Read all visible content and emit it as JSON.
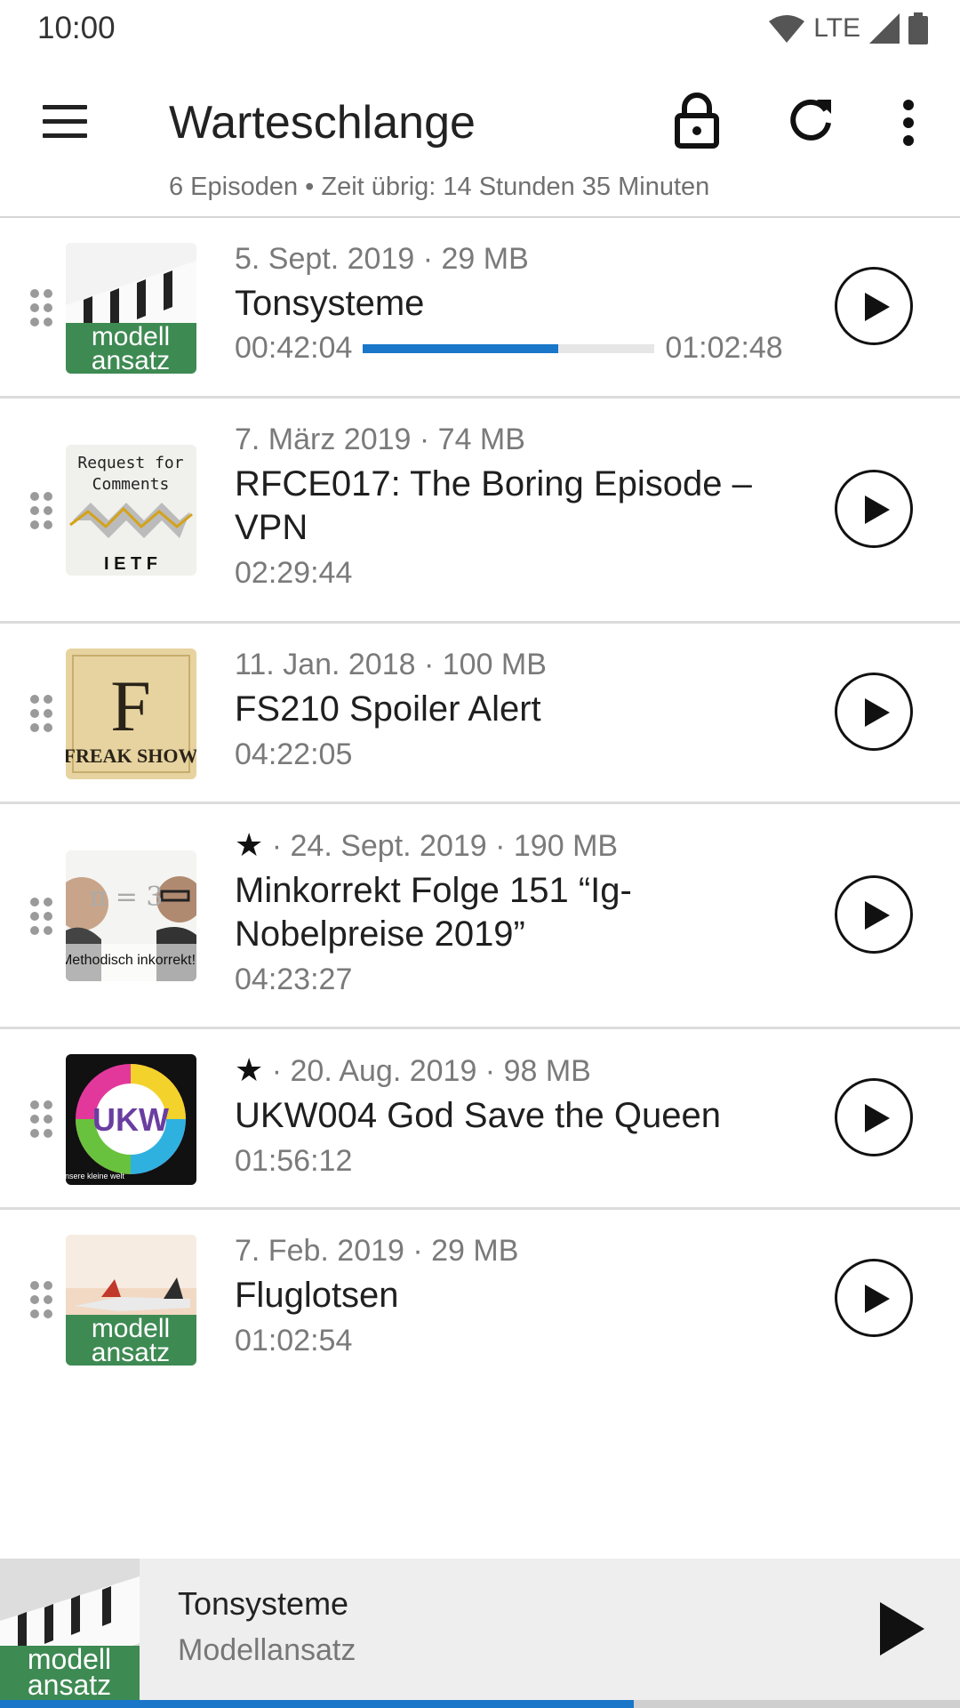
{
  "status_bar": {
    "time": "10:00",
    "network": "LTE"
  },
  "toolbar": {
    "title": "Warteschlange",
    "subtitle": "6 Episoden • Zeit übrig: 14 Stunden 35 Minuten"
  },
  "episodes": [
    {
      "meta": "5. Sept. 2019 · 29 MB",
      "starred": false,
      "title": "Tonsysteme",
      "position": "00:42:04",
      "duration": "01:02:48",
      "progress": 0.67,
      "cover": {
        "label_top": "modell",
        "label_bottom": "ansatz",
        "style": "piano"
      }
    },
    {
      "meta": "7. März 2019 · 74 MB",
      "starred": false,
      "title": "RFCE017: The Boring Episode – VPN",
      "duration": "02:29:44",
      "cover": {
        "label_top": "Request for",
        "label_mid": "Comments",
        "label_bottom": "I E T F",
        "style": "ietf"
      }
    },
    {
      "meta": "11. Jan. 2018 · 100 MB",
      "starred": false,
      "title": "FS210 Spoiler Alert",
      "duration": "04:22:05",
      "cover": {
        "label_top": "F",
        "label_bottom": "FREAK SHOW",
        "style": "freakshow"
      }
    },
    {
      "meta": "· 24. Sept. 2019 · 190 MB",
      "starred": true,
      "title": "Minkorrekt Folge 151 “Ig-Nobelpreise 2019”",
      "duration": "04:23:27",
      "cover": {
        "label_top": "π = 3",
        "label_bottom": "Methodisch inkorrekt!",
        "style": "minkorrekt"
      }
    },
    {
      "meta": "· 20. Aug. 2019 · 98 MB",
      "starred": true,
      "title": "UKW004 God Save the Queen",
      "duration": "01:56:12",
      "cover": {
        "label_top": "UKW",
        "label_bottom": "unsere kleine welt",
        "style": "ukw"
      }
    },
    {
      "meta": "7. Feb. 2019 · 29 MB",
      "starred": false,
      "title": "Fluglotsen",
      "duration": "01:02:54",
      "cover": {
        "label_top": "modell",
        "label_bottom": "ansatz",
        "style": "airport"
      }
    }
  ],
  "mini_player": {
    "title": "Tonsysteme",
    "podcast": "Modellansatz",
    "progress": 0.66,
    "cover": {
      "label_top": "modell",
      "label_bottom": "ansatz"
    }
  },
  "colors": {
    "accent": "#1976c8",
    "divider": "#dcdcdc",
    "secondary_text": "#7a7a7a"
  }
}
